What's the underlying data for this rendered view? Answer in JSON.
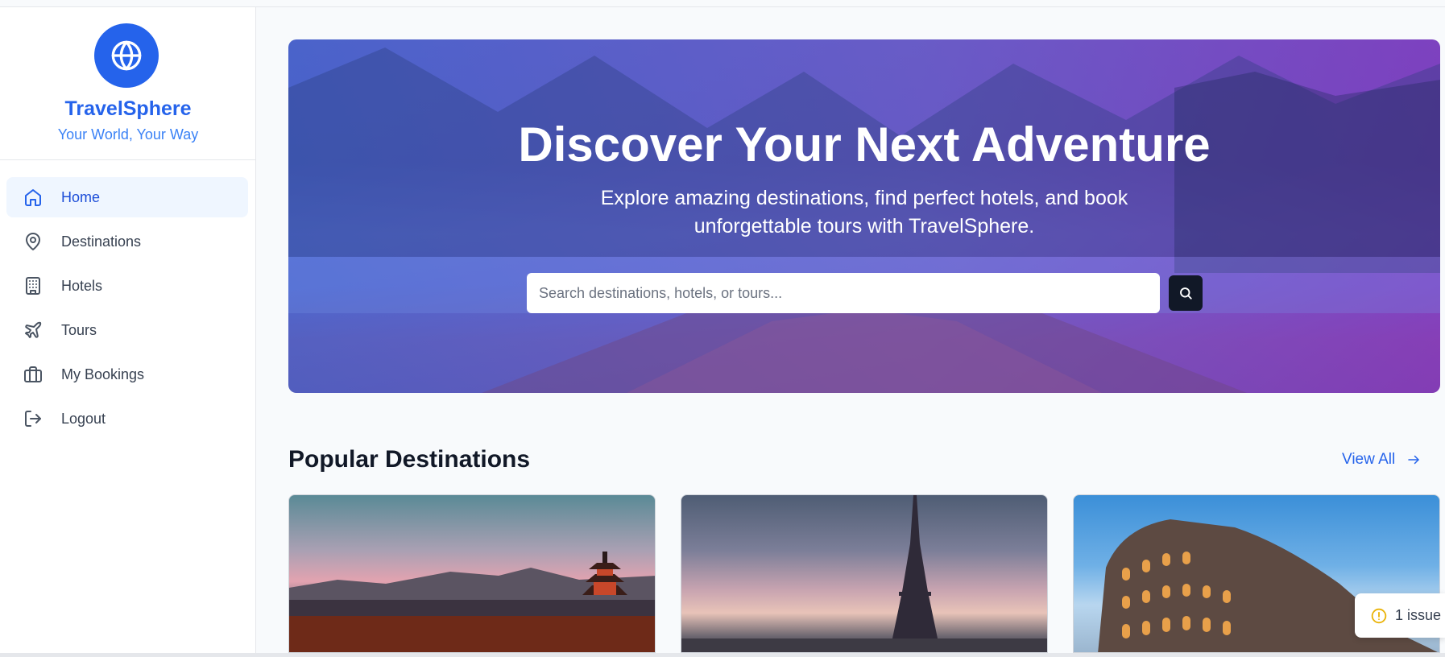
{
  "brand": {
    "name": "TravelSphere",
    "tagline": "Your World, Your Way",
    "logo_icon": "globe-icon",
    "color": "#2563eb"
  },
  "sidebar": {
    "items": [
      {
        "label": "Home",
        "icon": "home-icon",
        "active": true
      },
      {
        "label": "Destinations",
        "icon": "map-pin-icon",
        "active": false
      },
      {
        "label": "Hotels",
        "icon": "building-icon",
        "active": false
      },
      {
        "label": "Tours",
        "icon": "plane-icon",
        "active": false
      },
      {
        "label": "My Bookings",
        "icon": "briefcase-icon",
        "active": false
      },
      {
        "label": "Logout",
        "icon": "logout-icon",
        "active": false
      }
    ]
  },
  "hero": {
    "title": "Discover Your Next Adventure",
    "subtitle": "Explore amazing destinations, find perfect hotels, and book unforgettable tours with TravelSphere.",
    "search_placeholder": "Search destinations, hotels, or tours...",
    "search_icon": "search-icon"
  },
  "popular": {
    "title": "Popular Destinations",
    "view_all": "View All",
    "cards": [
      {
        "image": "kyoto-pagoda-image"
      },
      {
        "image": "eiffel-tower-image"
      },
      {
        "image": "colosseum-image"
      }
    ]
  },
  "issue_badge": {
    "label": "1 issue",
    "color": "#eab308"
  }
}
